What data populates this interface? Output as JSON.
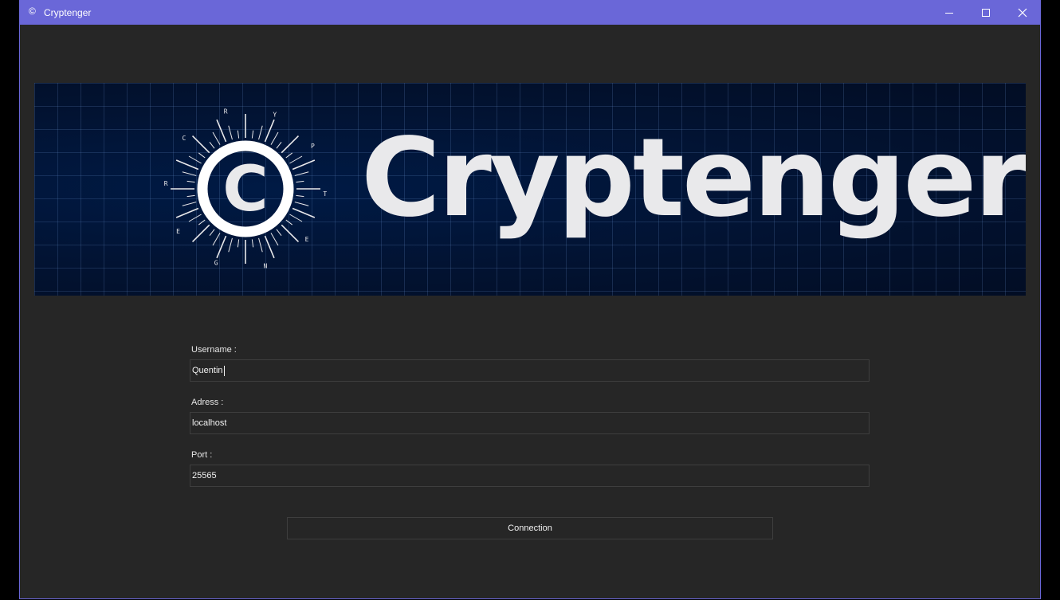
{
  "window": {
    "title": "Cryptenger",
    "app_icon": "©",
    "controls": [
      "minimize-icon",
      "maximize-icon",
      "close-icon"
    ]
  },
  "banner": {
    "logo_letter": "C",
    "wordmark": "Cryptenger",
    "ring_letters": [
      "C",
      "R",
      "Y",
      "P",
      "T",
      "E",
      "N",
      "G",
      "E",
      "R"
    ]
  },
  "form": {
    "username_label": "Username :",
    "username_value": "Quentin",
    "address_label": "Adress :",
    "address_value": "localhost",
    "port_label": "Port :",
    "port_value": "25565",
    "connect_label": "Connection"
  },
  "colors": {
    "titlebar": "#6a67d8",
    "window_bg": "#262626",
    "banner_bg": "#021230",
    "text": "#e6e6e6"
  }
}
